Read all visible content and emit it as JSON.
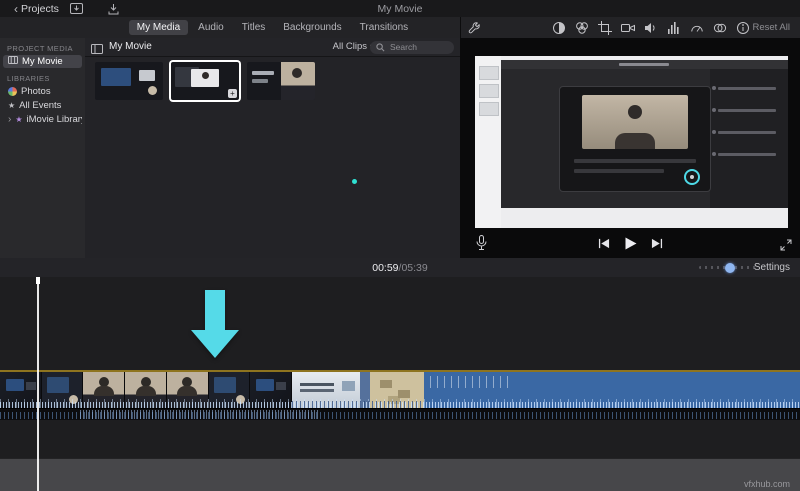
{
  "titlebar": {
    "back": "Projects",
    "title": "My Movie"
  },
  "tabs": {
    "items": [
      "My Media",
      "Audio",
      "Titles",
      "Backgrounds",
      "Transitions"
    ],
    "active": "My Media"
  },
  "sidebar": {
    "project_media_header": "PROJECT MEDIA",
    "project_item": "My Movie",
    "libraries_header": "LIBRARIES",
    "lib_items": [
      "Photos",
      "All Events",
      "iMovie Library"
    ],
    "selected": "My Movie"
  },
  "browser": {
    "heading": "My Movie",
    "filter": "All Clips",
    "search_placeholder": "Search"
  },
  "viewer": {
    "reset_all": "Reset All"
  },
  "timeline": {
    "current": "00:59",
    "separator": " / ",
    "total": "05:39",
    "settings": "Settings"
  },
  "watermark": "vfxhub.com",
  "icons": {
    "chevron_left": "‹",
    "disclosure": "›",
    "dropdown": "▾",
    "star": "★",
    "plus": "+"
  },
  "colors": {
    "accent_cyan": "#55dae8",
    "audio_clip_blue": "#3a68a4",
    "selection_orange": "#8e741f",
    "pointer_teal": "#2fe0d2"
  }
}
